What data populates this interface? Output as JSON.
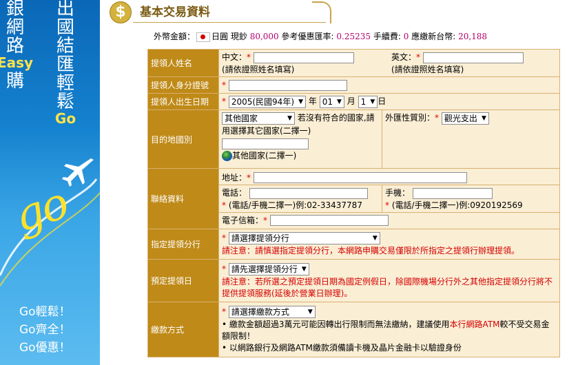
{
  "banner": {
    "col1": [
      "銀",
      "網",
      "路"
    ],
    "col1_en": "Easy",
    "col1_tail": [
      "購"
    ],
    "col2": [
      "出",
      "國",
      "結",
      "匯",
      "輕",
      "鬆"
    ],
    "col2_en": "Go",
    "go_script": "go",
    "slogans": [
      "Go輕鬆！",
      "Go齊全！",
      "Go優惠！"
    ]
  },
  "header": {
    "icon": "dollar-coin-icon",
    "coin_glyph": "$",
    "title": "基本交易資料"
  },
  "fx": {
    "label": "外幣金額：",
    "currency": "日圓",
    "cash_label": "現鈔",
    "amount": "80,000",
    "rate_label": "參考優惠匯率:",
    "rate": "0.25235",
    "fee_label": "手續費:",
    "fee": "0",
    "total_label": "應繳新台幣:",
    "total": "20,188"
  },
  "form": {
    "name": {
      "label": "提領人姓名",
      "zh_label": "中文：",
      "en_label": "英文：",
      "hint": "(請依證照姓名填寫)"
    },
    "id": {
      "label": "提領人身分證號"
    },
    "birth": {
      "label": "提領人出生日期",
      "year": "2005(民國94年)",
      "year_unit": "年",
      "month": "01",
      "month_unit": "月",
      "day": "1",
      "day_unit": "日"
    },
    "dest": {
      "label": "目的地國別",
      "country": "其他國家",
      "note": "若沒有符合的國家,請用選擇其它國家(二擇一)",
      "other_label": "其他國家(二擇一)",
      "purpose_label": "外匯性質別：",
      "purpose": "觀光支出"
    },
    "contact": {
      "label": "聯絡資料",
      "address_label": "地址：",
      "phone_label": "電話：",
      "mobile_label": "手機：",
      "phone_hint": "(電話/手機二擇一)例:02-33437787",
      "mobile_hint": "(電話/手機二擇一)例:0920192569",
      "email_label": "電子信箱："
    },
    "branch": {
      "label": "指定提領分行",
      "select": "請選擇提領分行",
      "note": "請注意：請慎選指定提領分行，本網路申購交易僅限於所指定之提領行辦理提領。"
    },
    "pickup": {
      "label": "預定提領日",
      "select": "請先選擇提領分行",
      "note": "請注意：若所選之預定提領日期為國定例假日，除國際機場分行外之其他指定提領分行將不提供提領服務(延後於營業日辦理)。"
    },
    "payment": {
      "label": "繳款方式",
      "select": "請選擇繳款方式",
      "bullet1_a": "繳款金額超過3萬元可能因轉出行限制而無法繳納，建議使用",
      "bullet1_b": "本行網路ATM",
      "bullet1_c": "較不受交易金額限制！",
      "bullet2": "以網路銀行及網路ATM繳款須備讀卡機及晶片金融卡以驗證身份"
    }
  },
  "required_mark": "*"
}
